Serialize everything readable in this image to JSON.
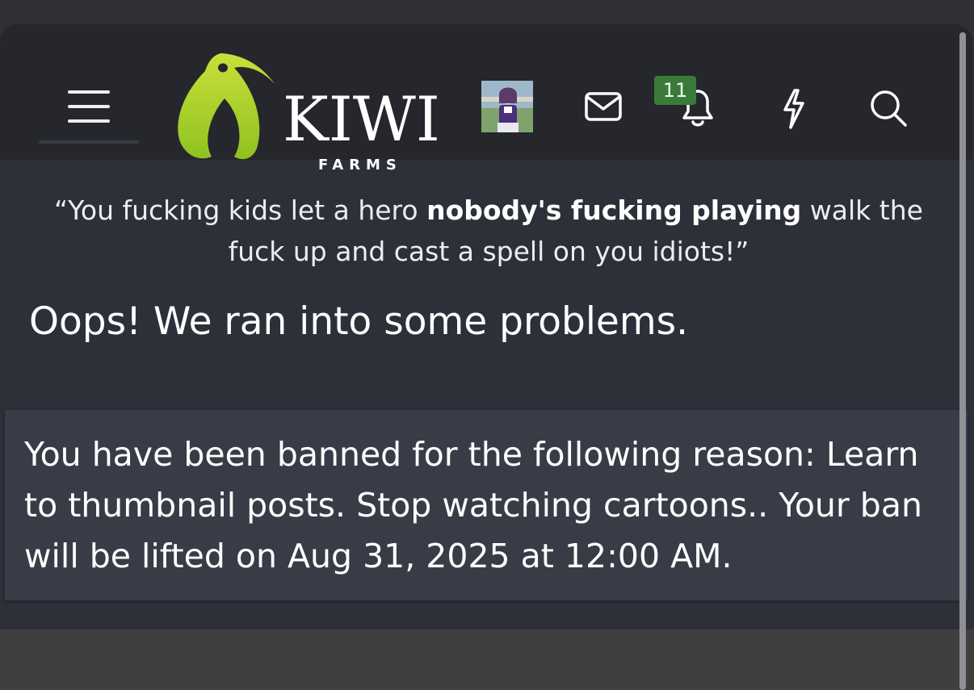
{
  "header": {
    "logo_word": "KIWI",
    "logo_sub": "FARMS",
    "notifications_count": "11",
    "colors": {
      "accent_green": "#a7d42a",
      "badge_green": "#3a7a3a",
      "header_bg": "#25272c"
    },
    "icons": [
      "menu-icon",
      "kiwi-logo-icon",
      "avatar",
      "mail-icon",
      "bell-icon",
      "lightning-icon",
      "search-icon"
    ]
  },
  "quote": {
    "open": "“You fucking kids let a hero ",
    "bold": "nobody's fucking playing",
    "close": " walk the fuck up and cast a spell on you idiots!”"
  },
  "error": {
    "title": "Oops! We ran into some problems.",
    "ban_message": "You have been banned for the following reason: Learn to thumbnail posts. Stop watching cartoons.. Your ban will be lifted on Aug 31, 2025 at 12:00 AM."
  }
}
